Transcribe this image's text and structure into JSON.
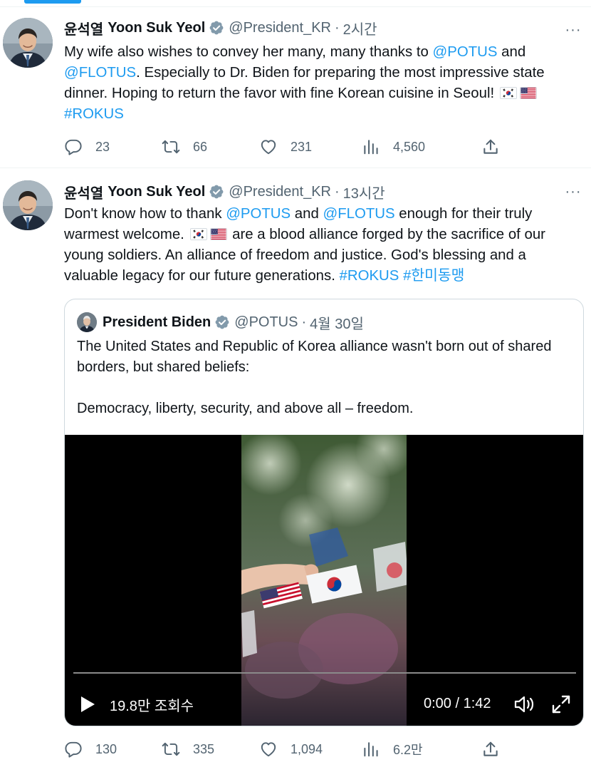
{
  "tweets": [
    {
      "name_ko": "윤석열",
      "name_en": "Yoon Suk Yeol",
      "handle": "@President_KR",
      "separator": "·",
      "time": "2시간",
      "more_label": "···",
      "text": {
        "p1": "My wife also wishes to convey her many, many thanks to ",
        "mention1": "@POTUS",
        "p2": " and",
        "mention2": "@FLOTUS",
        "p3": ". Especially to Dr. Biden for preparing the most impressive state dinner. Hoping to return the favor with fine Korean cuisine in Seoul! ",
        "hashtag1": "#ROKUS"
      },
      "actions": {
        "replies": "23",
        "retweets": "66",
        "likes": "231",
        "views": "4,560"
      }
    },
    {
      "name_ko": "윤석열",
      "name_en": "Yoon Suk Yeol",
      "handle": "@President_KR",
      "separator": "·",
      "time": "13시간",
      "more_label": "···",
      "text": {
        "p1": "Don't know how to thank ",
        "mention1": "@POTUS",
        "p2": " and ",
        "mention2": "@FLOTUS",
        "p3": " enough for their truly warmest welcome. ",
        "p4": " are a blood alliance forged by the sacrifice of our young soldiers. An alliance of freedom and justice. God's blessing and a valuable legacy for our future generations. ",
        "hashtag1": "#ROKUS",
        "hashtag2": "#한미동맹"
      },
      "quote": {
        "name": "President Biden",
        "handle": "@POTUS",
        "separator": "·",
        "date": "4월 30일",
        "line1": "The United States and Republic of Korea alliance wasn't born out of shared borders, but shared beliefs:",
        "line2": "Democracy, liberty, security, and above all – freedom.",
        "video": {
          "views": "19.8만 조회수",
          "time": "0:00 / 1:42",
          "progress": 0
        }
      },
      "actions": {
        "replies": "130",
        "retweets": "335",
        "likes": "1,094",
        "views": "6.2만"
      }
    }
  ],
  "colors": {
    "accent": "#1d9bf0",
    "text": "#0f1419",
    "secondary": "#536471",
    "border": "#cfd9de"
  },
  "icons": [
    "verified-badge-icon",
    "more-icon",
    "reply-icon",
    "retweet-icon",
    "like-icon",
    "views-icon",
    "share-icon",
    "play-icon",
    "volume-icon",
    "fullscreen-icon",
    "south-korea-flag-icon",
    "usa-flag-icon"
  ]
}
